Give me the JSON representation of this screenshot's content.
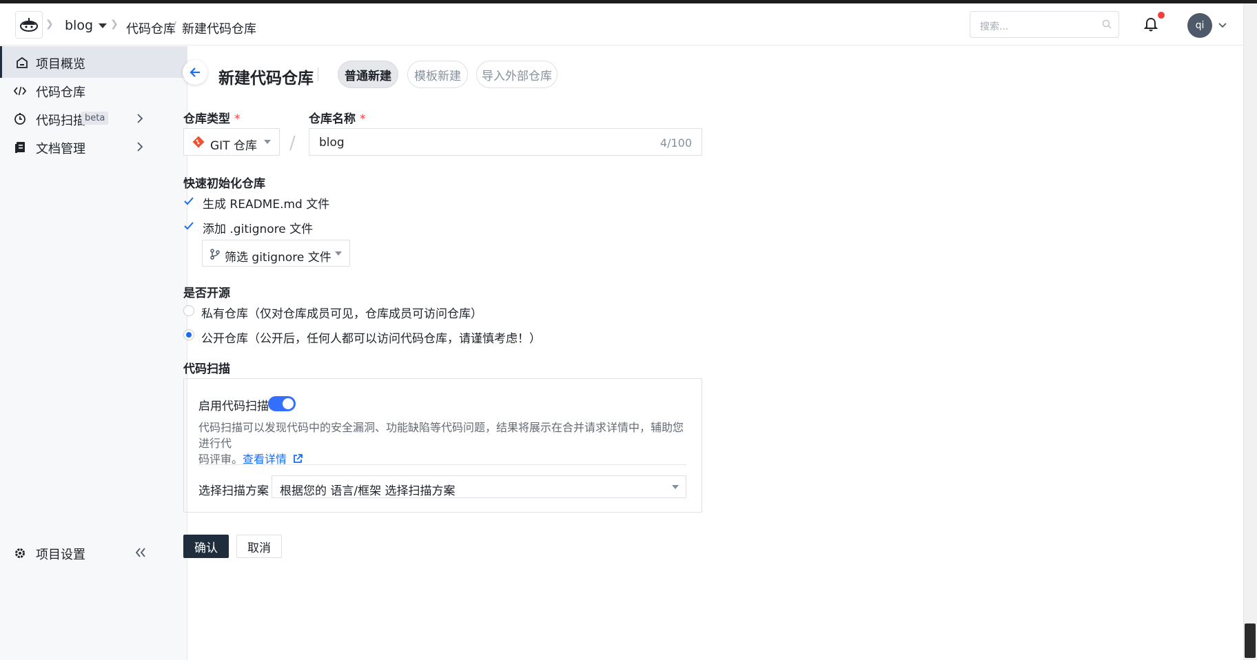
{
  "header": {
    "breadcrumb": [
      "blog",
      "代码仓库",
      "新建代码仓库"
    ],
    "search_placeholder": "搜索...",
    "user_initials": "qi"
  },
  "sidebar": {
    "items": [
      {
        "label": "项目概览",
        "icon": "home-icon",
        "active": true
      },
      {
        "label": "代码仓库",
        "icon": "code-icon",
        "active": false
      },
      {
        "label": "代码扫描",
        "icon": "scan-icon",
        "badge": "beta",
        "has_children": true
      },
      {
        "label": "文档管理",
        "icon": "document-icon",
        "has_children": true
      }
    ],
    "settings_label": "项目设置"
  },
  "page": {
    "title": "新建代码仓库",
    "tabs": [
      {
        "label": "普通新建",
        "active": true
      },
      {
        "label": "模板新建",
        "active": false
      },
      {
        "label": "导入外部仓库",
        "active": false
      }
    ]
  },
  "form": {
    "repo_type_label": "仓库类型",
    "repo_type_value": "GIT 仓库",
    "repo_name_label": "仓库名称",
    "repo_name_value": "blog",
    "repo_name_count": "4/100",
    "quick_init_label": "快速初始化仓库",
    "readme_label": "生成 README.md 文件",
    "readme_checked": true,
    "gitignore_label": "添加 .gitignore 文件",
    "gitignore_checked": true,
    "gitignore_select_placeholder": "筛选 gitignore 文件",
    "open_source_label": "是否开源",
    "private_label": "私有仓库（仅对仓库成员可见，仓库成员可访问仓库）",
    "public_label": "公开仓库（公开后，任何人都可以访问代码仓库，请谨慎考虑！）",
    "visibility": "public",
    "scan_section_label": "代码扫描",
    "enable_scan_label": "启用代码扫描",
    "enable_scan_on": true,
    "scan_desc_line1": "代码扫描可以发现代码中的安全漏洞、功能缺陷等代码问题，结果将展示在合并请求详情中，辅助您进行代",
    "scan_desc_line2": "码评审。",
    "scan_desc_link": "查看详情",
    "scan_plan_label": "选择扫描方案",
    "scan_plan_placeholder": "根据您的 语言/框架 选择扫描方案",
    "confirm_label": "确认",
    "cancel_label": "取消"
  },
  "colors": {
    "primary": "#1f2d3d",
    "accent_blue": "#1a6cf5",
    "required_red": "#f53f3f",
    "git_orange": "#f05033"
  }
}
